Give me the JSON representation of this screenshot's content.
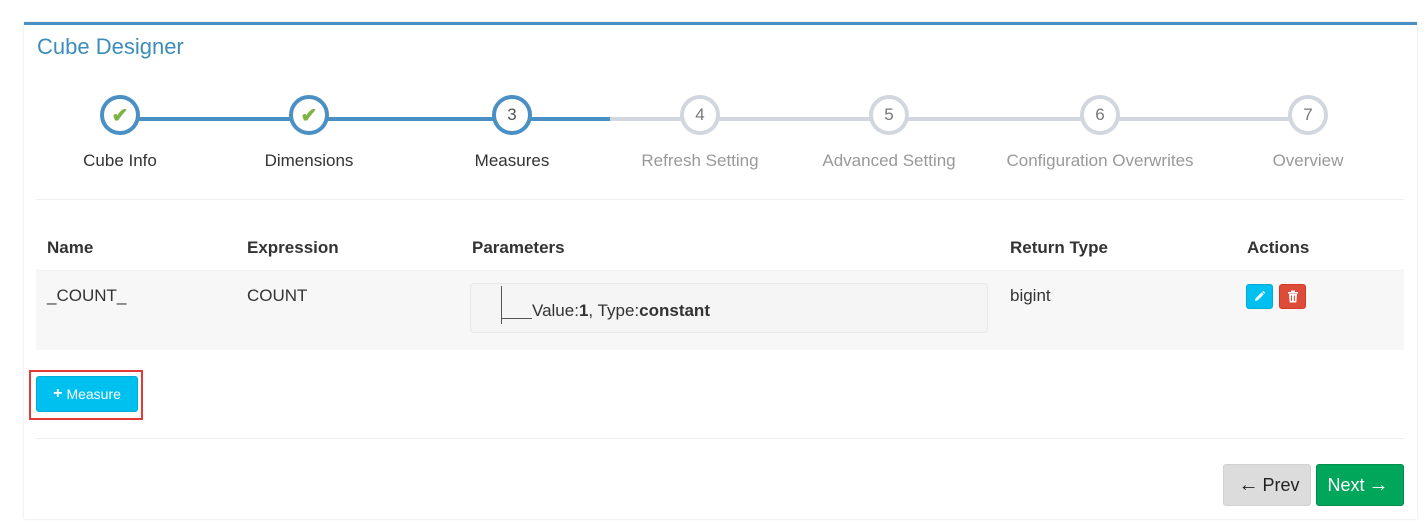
{
  "page": {
    "title": "Cube Designer"
  },
  "wizard": {
    "steps": [
      {
        "number": "1",
        "label": "Cube Info",
        "state": "done"
      },
      {
        "number": "2",
        "label": "Dimensions",
        "state": "done"
      },
      {
        "number": "3",
        "label": "Measures",
        "state": "active"
      },
      {
        "number": "4",
        "label": "Refresh Setting",
        "state": "todo"
      },
      {
        "number": "5",
        "label": "Advanced Setting",
        "state": "todo"
      },
      {
        "number": "6",
        "label": "Configuration Overwrites",
        "state": "todo"
      },
      {
        "number": "7",
        "label": "Overview",
        "state": "todo"
      }
    ]
  },
  "table": {
    "headers": [
      "Name",
      "Expression",
      "Parameters",
      "Return Type",
      "Actions"
    ],
    "rows": [
      {
        "name": "_COUNT_",
        "expression": "COUNT",
        "param_value_label": "Value:",
        "param_value": "1",
        "param_type_label": ", Type:",
        "param_type": "constant",
        "return_type": "bigint",
        "actions": [
          "pencil-icon",
          "trash-icon"
        ]
      }
    ]
  },
  "buttons": {
    "add_measure_label": "Measure",
    "prev_label": "Prev",
    "next_label": "Next"
  },
  "colors": {
    "primary": "#4a90c4",
    "info": "#00c0ef",
    "danger": "#dd4b39",
    "success": "#00a65a",
    "check": "#7cb342"
  }
}
